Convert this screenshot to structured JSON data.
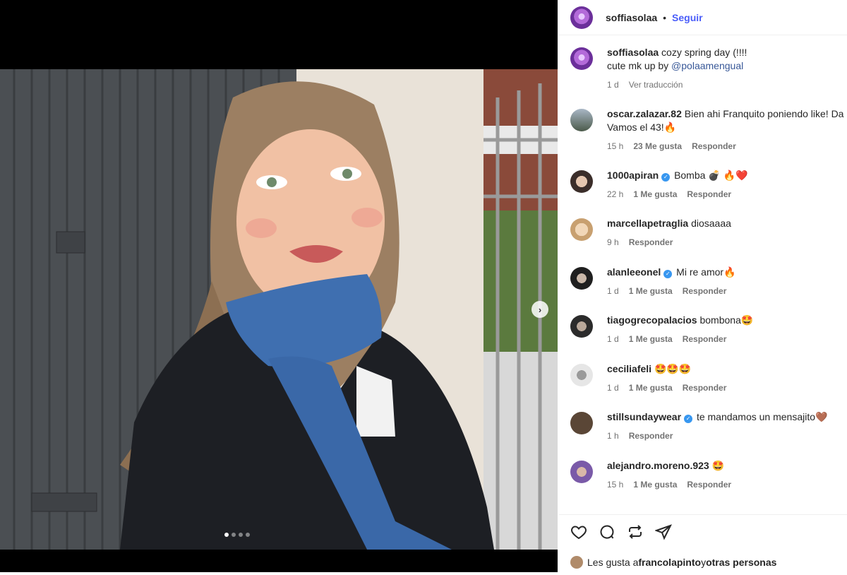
{
  "header": {
    "username": "soffiasolaa",
    "separator": "•",
    "follow_label": "Seguir"
  },
  "caption": {
    "username": "soffiasolaa",
    "text_line1": "cozy spring day (!!!!",
    "text_line2_prefix": "cute mk up by ",
    "mention": "@polaamengual",
    "time": "1 d",
    "translate_label": "Ver traducción"
  },
  "comments": [
    {
      "username": "oscar.zalazar.82",
      "verified": false,
      "text": "Bien ahi Franquito poniendo like! Da",
      "text2": "Vamos el 43!🔥",
      "time": "15 h",
      "likes": "23 Me gusta",
      "reply": "Responder"
    },
    {
      "username": "1000apiran",
      "verified": true,
      "text": "Bomba 💣 🔥❤️",
      "time": "22 h",
      "likes": "1 Me gusta",
      "reply": "Responder"
    },
    {
      "username": "marcellapetraglia",
      "verified": false,
      "text": "diosaaaa",
      "time": "9 h",
      "likes": "",
      "reply": "Responder"
    },
    {
      "username": "alanleeonel",
      "verified": true,
      "text": "Mi re amor🔥",
      "time": "1 d",
      "likes": "1 Me gusta",
      "reply": "Responder"
    },
    {
      "username": "tiagogrecopalacios",
      "verified": false,
      "text": "bombona🤩",
      "time": "1 d",
      "likes": "1 Me gusta",
      "reply": "Responder"
    },
    {
      "username": "ceciliafeli",
      "verified": false,
      "text": "🤩🤩🤩",
      "time": "1 d",
      "likes": "1 Me gusta",
      "reply": "Responder"
    },
    {
      "username": "stillsundaywear",
      "verified": true,
      "text": "te mandamos un mensajito🤎",
      "time": "1 h",
      "likes": "",
      "reply": "Responder"
    },
    {
      "username": "alejandro.moreno.923",
      "verified": false,
      "text": "🤩",
      "time": "15 h",
      "likes": "1 Me gusta",
      "reply": "Responder"
    }
  ],
  "likes_line": {
    "prefix": "Les gusta a ",
    "user": "francolapinto",
    "middle": " y ",
    "others": "otras personas"
  },
  "icons": [
    "heart-icon",
    "comment-icon",
    "repost-icon",
    "share-icon",
    "chevron-right-icon"
  ],
  "media": {
    "carousel_count": 4,
    "carousel_active": 1
  },
  "colors": {
    "follow": "#4a5df9",
    "mention": "#385898",
    "verified": "#3897f0",
    "muted": "#737373"
  }
}
